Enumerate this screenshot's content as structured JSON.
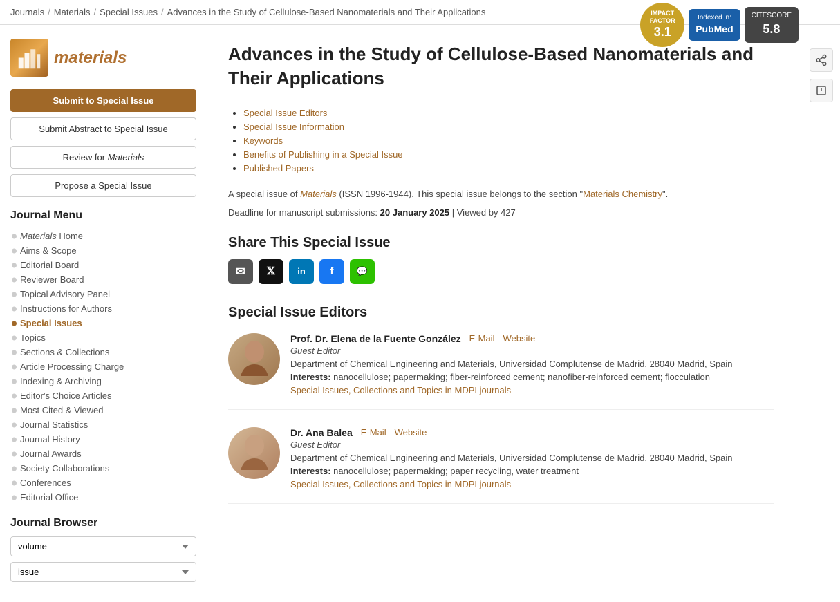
{
  "breadcrumb": {
    "items": [
      "Journals",
      "Materials",
      "Special Issues"
    ],
    "current": "Advances in the Study of Cellulose-Based Nanomaterials and Their Applications"
  },
  "badges": {
    "impact_factor_label": "IMPACT FACTOR",
    "impact_factor_value": "3.1",
    "indexed_label": "Indexed in:",
    "indexed_name": "PubMed",
    "citescore_label": "CITESCORE",
    "citescore_value": "5.8"
  },
  "logo": {
    "text": "materials",
    "icon": "📊"
  },
  "buttons": {
    "submit": "Submit to Special Issue",
    "submit_abstract": "Submit Abstract to Special Issue",
    "review": "Review for Materials",
    "propose": "Propose a Special Issue"
  },
  "journal_menu": {
    "title": "Journal Menu",
    "items": [
      {
        "label": "Materials Home",
        "italic_part": "Materials",
        "active": false
      },
      {
        "label": "Aims & Scope",
        "active": false
      },
      {
        "label": "Editorial Board",
        "active": false
      },
      {
        "label": "Reviewer Board",
        "active": false
      },
      {
        "label": "Topical Advisory Panel",
        "active": false
      },
      {
        "label": "Instructions for Authors",
        "active": false
      },
      {
        "label": "Special Issues",
        "active": true
      },
      {
        "label": "Topics",
        "active": false
      },
      {
        "label": "Sections & Collections",
        "active": false
      },
      {
        "label": "Article Processing Charge",
        "active": false
      },
      {
        "label": "Indexing & Archiving",
        "active": false
      },
      {
        "label": "Editor's Choice Articles",
        "active": false
      },
      {
        "label": "Most Cited & Viewed",
        "active": false
      },
      {
        "label": "Journal Statistics",
        "active": false
      },
      {
        "label": "Journal History",
        "active": false
      },
      {
        "label": "Journal Awards",
        "active": false
      },
      {
        "label": "Society Collaborations",
        "active": false
      },
      {
        "label": "Conferences",
        "active": false
      },
      {
        "label": "Editorial Office",
        "active": false
      }
    ]
  },
  "journal_browser": {
    "title": "Journal Browser",
    "volume_placeholder": "volume",
    "issue_placeholder": "issue"
  },
  "article": {
    "title": "Advances in the Study of Cellulose-Based Nanomaterials and Their Applications",
    "toc": [
      "Special Issue Editors",
      "Special Issue Information",
      "Keywords",
      "Benefits of Publishing in a Special Issue",
      "Published Papers"
    ],
    "description_prefix": "A special issue of ",
    "journal_name": "Materials",
    "issn": "(ISSN 1996-1944). This special issue belongs to the section \"",
    "section_name": "Materials Chemistry",
    "section_suffix": "\".",
    "deadline_label": "Deadline for manuscript submissions:",
    "deadline_date": "20 January 2025",
    "viewed_text": "| Viewed by 427"
  },
  "share": {
    "title": "Share This Special Issue",
    "icons": [
      {
        "name": "email",
        "symbol": "✉",
        "label": "Email"
      },
      {
        "name": "twitter-x",
        "symbol": "𝕏",
        "label": "Twitter/X"
      },
      {
        "name": "linkedin",
        "symbol": "in",
        "label": "LinkedIn"
      },
      {
        "name": "facebook",
        "symbol": "f",
        "label": "Facebook"
      },
      {
        "name": "wechat",
        "symbol": "💬",
        "label": "WeChat"
      }
    ]
  },
  "editors": {
    "title": "Special Issue Editors",
    "list": [
      {
        "name": "Prof. Dr. Elena de la Fuente González",
        "email_label": "E-Mail",
        "website_label": "Website",
        "role": "Guest Editor",
        "dept": "Department of Chemical Engineering and Materials, Universidad Complutense de Madrid, 28040 Madrid, Spain",
        "interests_label": "Interests:",
        "interests": "nanocellulose; papermaking; fiber-reinforced cement; nanofiber-reinforced cement; flocculation",
        "special_issues_text": "Special Issues, Collections and Topics in MDPI journals"
      },
      {
        "name": "Dr. Ana Balea",
        "email_label": "E-Mail",
        "website_label": "Website",
        "role": "Guest Editor",
        "dept": "Department of Chemical Engineering and Materials, Universidad Complutense de Madrid, 28040 Madrid, Spain",
        "interests_label": "Interests:",
        "interests": "nanocellulose; papermaking; paper recycling, water treatment",
        "special_issues_text": "Special Issues, Collections and Topics in MDPI journals"
      }
    ]
  }
}
